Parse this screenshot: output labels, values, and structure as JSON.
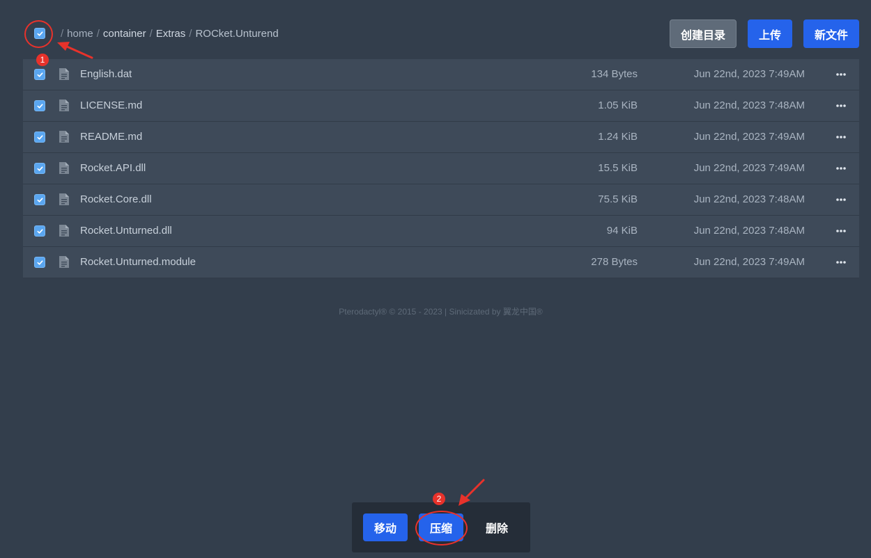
{
  "breadcrumb": {
    "root": "home",
    "segments": [
      "container",
      "Extras"
    ],
    "current": "ROCket.Unturend"
  },
  "toolbar": {
    "mkdir_label": "创建目录",
    "upload_label": "上传",
    "newfile_label": "新文件"
  },
  "files": [
    {
      "name": "English.dat",
      "size": "134 Bytes",
      "date": "Jun 22nd, 2023 7:49AM"
    },
    {
      "name": "LICENSE.md",
      "size": "1.05 KiB",
      "date": "Jun 22nd, 2023 7:48AM"
    },
    {
      "name": "README.md",
      "size": "1.24 KiB",
      "date": "Jun 22nd, 2023 7:49AM"
    },
    {
      "name": "Rocket.API.dll",
      "size": "15.5 KiB",
      "date": "Jun 22nd, 2023 7:49AM"
    },
    {
      "name": "Rocket.Core.dll",
      "size": "75.5 KiB",
      "date": "Jun 22nd, 2023 7:48AM"
    },
    {
      "name": "Rocket.Unturned.dll",
      "size": "94 KiB",
      "date": "Jun 22nd, 2023 7:48AM"
    },
    {
      "name": "Rocket.Unturned.module",
      "size": "278 Bytes",
      "date": "Jun 22nd, 2023 7:49AM"
    }
  ],
  "footer": {
    "text": "Pterodactyl® © 2015 - 2023 | Sinicizated by 翼龙中国®"
  },
  "mass_actions": {
    "move_label": "移动",
    "compress_label": "压缩",
    "delete_label": "删除"
  },
  "annotations": {
    "step1": "1",
    "step2": "2",
    "color": "#e8322b"
  },
  "colors": {
    "background": "#333e4c",
    "row": "#3e4a59",
    "primary": "#2563eb",
    "checkbox": "#5aa6f0"
  },
  "icons": {
    "file": "file-text-icon",
    "more": "more-horizontal-icon",
    "check": "check-icon"
  }
}
